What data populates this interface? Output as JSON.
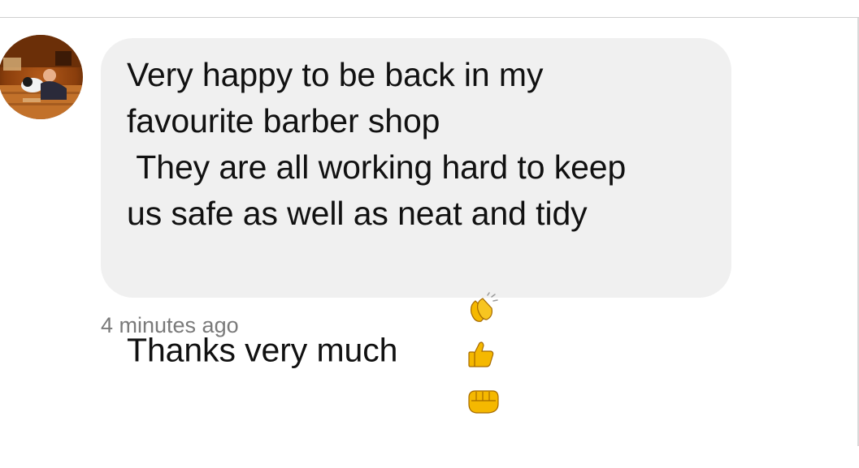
{
  "comment": {
    "avatar_icon": "user-avatar-photo",
    "text": "Very happy to be back in my\nfavourite barber shop\n They are all working hard to keep\nus safe as well as neat and tidy\nThanks very much ",
    "emojis": [
      "clapping-hands-icon",
      "thumbs-up-icon",
      "fist-bump-icon"
    ],
    "timestamp": "4 minutes ago"
  },
  "colors": {
    "bubble_background": "#f0f0f0",
    "text": "#111111",
    "timestamp": "#7a7a7a",
    "emoji_yellow": "#f5b800"
  }
}
